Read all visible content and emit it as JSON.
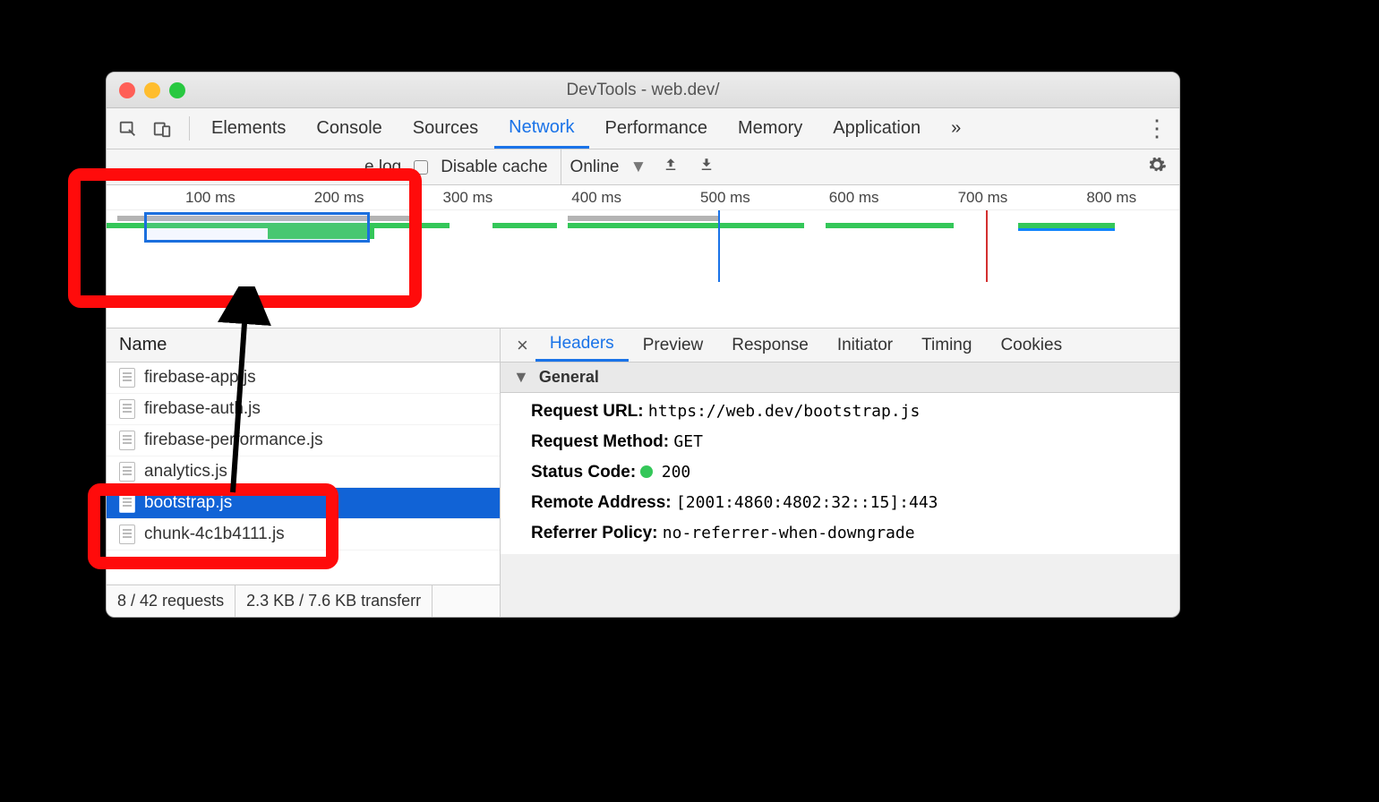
{
  "window": {
    "title": "DevTools - web.dev/"
  },
  "tabs": [
    "Elements",
    "Console",
    "Sources",
    "Network",
    "Performance",
    "Memory",
    "Application"
  ],
  "active_tab": "Network",
  "toolbar": {
    "preserve_log": "e log",
    "disable_cache": "Disable cache",
    "throttle": "Online"
  },
  "timeline_ticks": [
    "100 ms",
    "200 ms",
    "300 ms",
    "400 ms",
    "500 ms",
    "600 ms",
    "700 ms",
    "800 ms"
  ],
  "name_header": "Name",
  "files": [
    {
      "label": "firebase-app.js",
      "selected": false
    },
    {
      "label": "firebase-auth.js",
      "selected": false
    },
    {
      "label": "firebase-performance.js",
      "selected": false
    },
    {
      "label": "analytics.js",
      "selected": false
    },
    {
      "label": "bootstrap.js",
      "selected": true
    },
    {
      "label": "chunk-4c1b4111.js",
      "selected": false
    }
  ],
  "status": {
    "requests": "8 / 42 requests",
    "transfer": "2.3 KB / 7.6 KB transferr"
  },
  "detail_tabs": [
    "Headers",
    "Preview",
    "Response",
    "Initiator",
    "Timing",
    "Cookies"
  ],
  "detail_active": "Headers",
  "section_general": "General",
  "props": {
    "request_url_k": "Request URL:",
    "request_url_v": "https://web.dev/bootstrap.js",
    "request_method_k": "Request Method:",
    "request_method_v": "GET",
    "status_code_k": "Status Code:",
    "status_code_v": "200",
    "remote_addr_k": "Remote Address:",
    "remote_addr_v": "[2001:4860:4802:32::15]:443",
    "referrer_k": "Referrer Policy:",
    "referrer_v": "no-referrer-when-downgrade"
  }
}
